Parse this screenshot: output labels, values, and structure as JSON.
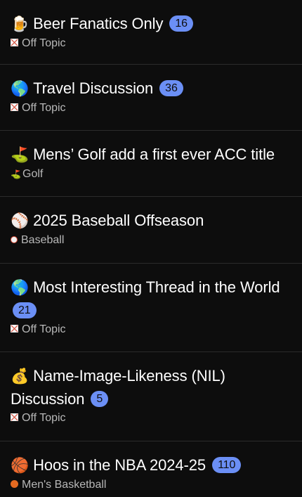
{
  "topics": [
    {
      "emoji": "🍺",
      "title": "Beer Fanatics Only",
      "badge": "16",
      "category": "Off Topic",
      "category_icon": "off-topic-icon"
    },
    {
      "emoji": "🌎",
      "title": "Travel Discussion",
      "badge": "36",
      "category": "Off Topic",
      "category_icon": "off-topic-icon"
    },
    {
      "emoji": "⛳",
      "title": "Mens’ Golf add a first ever ACC title",
      "badge": null,
      "category": "Golf",
      "category_icon": "golf-flag-icon"
    },
    {
      "emoji": "⚾",
      "title": "2025 Baseball Offseason",
      "badge": null,
      "category": "Baseball",
      "category_icon": "baseball-icon"
    },
    {
      "emoji": "🌎",
      "title": "Most Interesting Thread in the World",
      "badge": "21",
      "category": "Off Topic",
      "category_icon": "off-topic-icon"
    },
    {
      "emoji": "💰",
      "title": "Name-Image-Likeness (NIL) Discussion",
      "badge": "5",
      "category": "Off Topic",
      "category_icon": "off-topic-icon"
    },
    {
      "emoji": "🏀",
      "title": "Hoos in the NBA 2024-25",
      "badge": "110",
      "category": "Men's Basketball",
      "category_icon": "basketball-icon"
    }
  ],
  "colors": {
    "background": "#0d0d0d",
    "badge": "#6b8ff5",
    "divider": "#2b2b2b",
    "category_text": "#b8b8b8"
  }
}
